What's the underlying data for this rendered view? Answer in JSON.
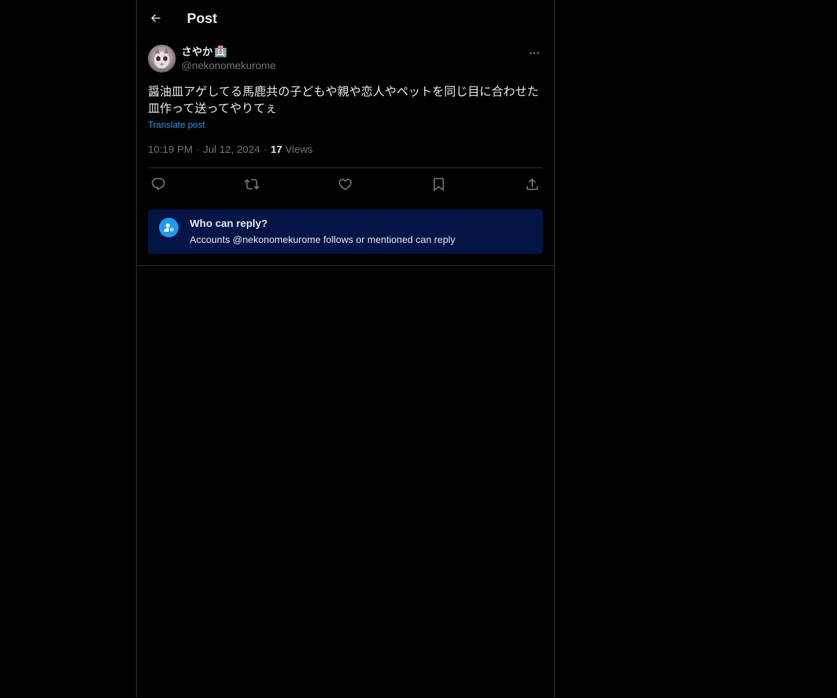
{
  "header": {
    "title": "Post",
    "back_icon": "arrow-left-icon"
  },
  "post": {
    "author": {
      "display_name": "さやか",
      "badge_emoji": "🏥",
      "handle": "@nekonomekurome"
    },
    "text_line1": "醤油皿アゲしてる馬鹿共の子どもや親や恋人やペットを同じ目に合わせた",
    "text_line2": "皿作って送ってやりてぇ",
    "translate_label": "Translate post",
    "time": "10:19 PM",
    "separator": "·",
    "date": "Jul 12, 2024",
    "views_count": "17",
    "views_label": "Views",
    "actions": [
      "reply-icon",
      "repost-icon",
      "like-icon",
      "bookmark-icon",
      "share-icon"
    ]
  },
  "who_can_reply": {
    "title": "Who can reply?",
    "subtitle": "Accounts @nekonomekurome follows or mentioned can reply"
  },
  "colors": {
    "background": "#000000",
    "text": "#e7e9ea",
    "secondary_text": "#71767b",
    "accent": "#1d9bf0",
    "border": "#2f3336",
    "info_box": "#031546"
  }
}
